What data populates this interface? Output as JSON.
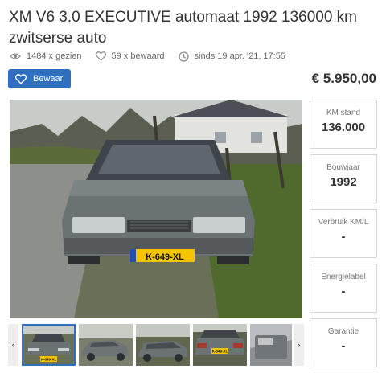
{
  "listing": {
    "title": "XM V6 3.0 EXECUTIVE automaat 1992 136000 km zwitserse auto",
    "views": "1484 x gezien",
    "saves": "59 x bewaard",
    "since": "sinds 19 apr. '21, 17:55",
    "save_label": "Bewaar",
    "price": "€ 5.950,00"
  },
  "photo": {
    "license_plate": "K-649-XL"
  },
  "specs": [
    {
      "label": "KM stand",
      "value": "136.000"
    },
    {
      "label": "Bouwjaar",
      "value": "1992"
    },
    {
      "label": "Verbruik KM/L",
      "value": "-"
    },
    {
      "label": "Energielabel",
      "value": "-"
    },
    {
      "label": "Garantie",
      "value": "-"
    }
  ],
  "thumbs": {
    "prev_icon": "‹",
    "next_icon": "›",
    "plate_1": "K-649-XL",
    "plate_4": "K-649-XL"
  },
  "colors": {
    "accent": "#2f6fc0",
    "text": "#333333",
    "muted": "#666666",
    "plate": "#f5c400"
  },
  "icons": [
    "eye-icon",
    "heart-icon",
    "clock-icon",
    "heart-icon",
    "chevron-left-icon",
    "chevron-right-icon"
  ]
}
